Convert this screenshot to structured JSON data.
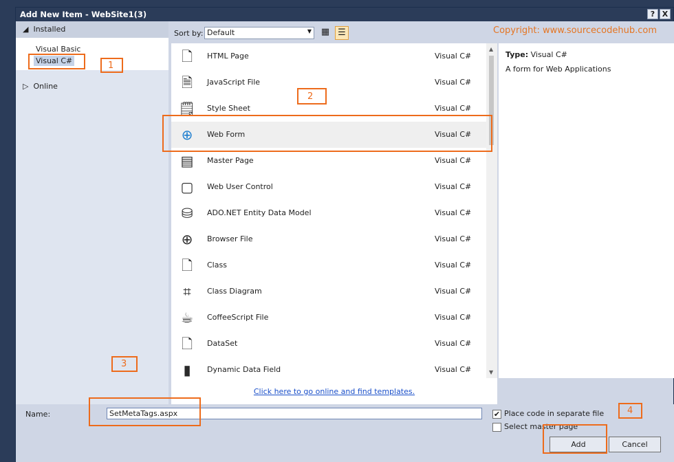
{
  "window": {
    "title": "Add New Item - WebSite1(3)",
    "help_btn": "?",
    "close_btn": "X"
  },
  "left": {
    "installed": "Installed",
    "languages": [
      "Visual Basic",
      "Visual C#"
    ],
    "online": "Online"
  },
  "sortbar": {
    "label": "Sort by:",
    "value": "Default"
  },
  "watermark": "Copyright: www.sourcecodehub.com",
  "items": [
    {
      "name": "HTML Page",
      "lang": "Visual C#"
    },
    {
      "name": "JavaScript File",
      "lang": "Visual C#"
    },
    {
      "name": "Style Sheet",
      "lang": "Visual C#"
    },
    {
      "name": "Web Form",
      "lang": "Visual C#"
    },
    {
      "name": "Master Page",
      "lang": "Visual C#"
    },
    {
      "name": "Web User Control",
      "lang": "Visual C#"
    },
    {
      "name": "ADO.NET Entity Data Model",
      "lang": "Visual C#"
    },
    {
      "name": "Browser File",
      "lang": "Visual C#"
    },
    {
      "name": "Class",
      "lang": "Visual C#"
    },
    {
      "name": "Class Diagram",
      "lang": "Visual C#"
    },
    {
      "name": "CoffeeScript File",
      "lang": "Visual C#"
    },
    {
      "name": "DataSet",
      "lang": "Visual C#"
    },
    {
      "name": "Dynamic Data Field",
      "lang": "Visual C#"
    }
  ],
  "selected_index": 3,
  "description": {
    "type_label": "Type:",
    "type_value": "Visual C#",
    "text": "A form for Web Applications"
  },
  "online_link": "Click here to go online and find templates.",
  "bottom": {
    "name_label": "Name:",
    "name_value": "SetMetaTags.aspx",
    "place_code": "Place code in separate file",
    "place_code_checked": true,
    "select_master": "Select master page",
    "select_master_checked": false,
    "add": "Add",
    "cancel": "Cancel"
  },
  "annotations": [
    "1",
    "2",
    "3",
    "4"
  ],
  "colors": {
    "accent": "#ed6b1b",
    "title": "#2b3c59",
    "link": "#1a4fc9"
  }
}
